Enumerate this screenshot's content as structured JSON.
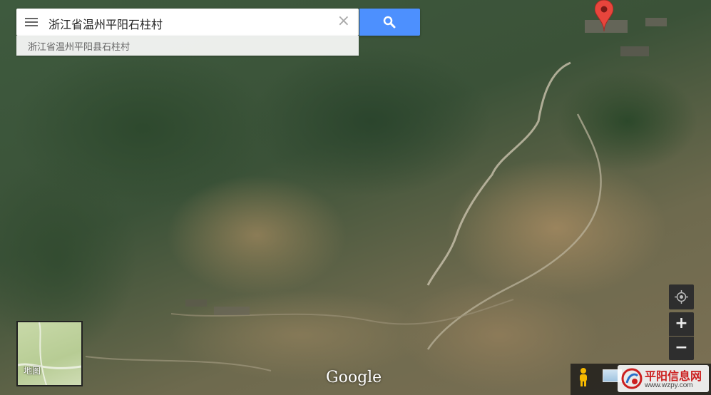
{
  "search": {
    "query": "浙江省温州平阳石柱村",
    "suggestion": "浙江省温州平阳县石柱村",
    "menu_icon": "hamburger-menu-icon",
    "clear_icon": "close-icon",
    "search_icon": "search-icon",
    "button_color": "#4d90fe"
  },
  "map": {
    "type": "satellite",
    "marker_color": "#e8453c"
  },
  "controls": {
    "zoom_in_label": "+",
    "zoom_out_label": "−",
    "locate_icon": "my-location-icon",
    "pegman_icon": "pegman-icon"
  },
  "minimap": {
    "label": "地图"
  },
  "branding": {
    "google_logo": "Google"
  },
  "watermark": {
    "title": "平阳信息网",
    "url": "www.wzpy.com"
  }
}
